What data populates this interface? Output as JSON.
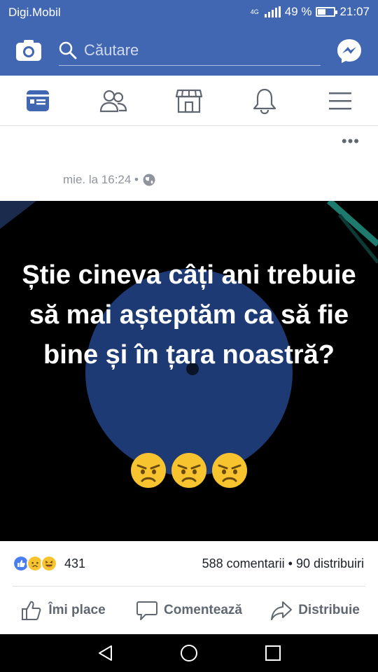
{
  "status_bar": {
    "carrier": "Digi.Mobil",
    "network": "4G",
    "battery": "49 %",
    "battery_level": 0.49,
    "time": "21:07"
  },
  "app_bar": {
    "search_placeholder": "Căutare"
  },
  "nav_tabs": [
    {
      "name": "news-feed",
      "icon": "news-feed-icon",
      "active": true
    },
    {
      "name": "friends",
      "icon": "friends-icon",
      "active": false
    },
    {
      "name": "marketplace",
      "icon": "store-icon",
      "active": false
    },
    {
      "name": "notifications",
      "icon": "bell-icon",
      "active": false
    },
    {
      "name": "menu",
      "icon": "hamburger-icon",
      "active": false
    }
  ],
  "post": {
    "more_label": "•••",
    "timestamp": "mie. la 16:24 •",
    "audience_icon": "globe-icon",
    "image_text": "Știe cineva câți ani trebuie să mai așteptăm ca să fie bine și în țara noastră?",
    "image_emojis": [
      "angry-face",
      "angry-face",
      "angry-face"
    ],
    "reactions": {
      "types": [
        "like",
        "sad",
        "haha"
      ],
      "count": "431"
    },
    "comments_shares": "588 comentarii • 90 distribuiri"
  },
  "actions": {
    "like": "Îmi place",
    "comment": "Comentează",
    "share": "Distribuie"
  },
  "colors": {
    "brand": "#4267b2",
    "text_secondary": "#606770",
    "meta": "#90949c",
    "image_bg": "#000000",
    "circle": "#1e3a74"
  }
}
